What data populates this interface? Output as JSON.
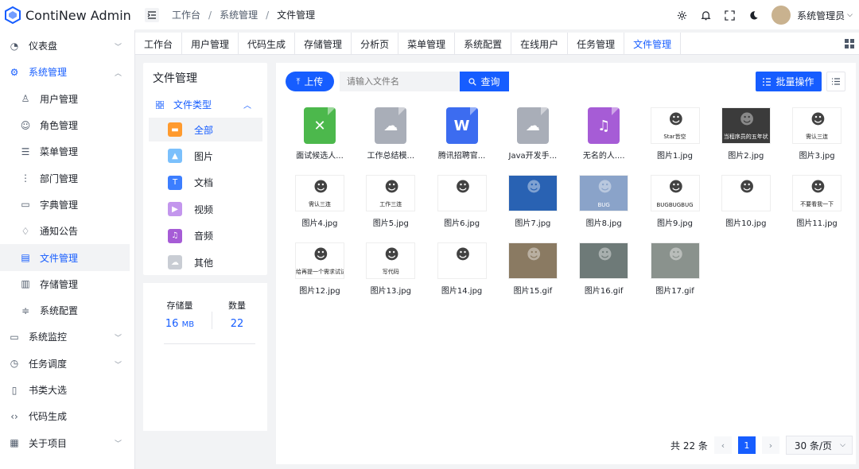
{
  "app": {
    "title": "ContiNew Admin"
  },
  "header": {
    "breadcrumb": [
      "工作台",
      "系统管理",
      "文件管理"
    ],
    "user_name": "系统管理员"
  },
  "sidebar": {
    "items": [
      {
        "label": "仪表盘",
        "icon": "dashboard-icon",
        "arrow": "down"
      },
      {
        "label": "系统管理",
        "icon": "gear-icon",
        "arrow": "up"
      },
      {
        "label": "用户管理",
        "icon": "user-icon"
      },
      {
        "label": "角色管理",
        "icon": "role-icon"
      },
      {
        "label": "菜单管理",
        "icon": "menu-icon"
      },
      {
        "label": "部门管理",
        "icon": "department-icon"
      },
      {
        "label": "字典管理",
        "icon": "dictionary-icon"
      },
      {
        "label": "通知公告",
        "icon": "bell-icon"
      },
      {
        "label": "文件管理",
        "icon": "file-icon"
      },
      {
        "label": "存储管理",
        "icon": "storage-icon"
      },
      {
        "label": "系统配置",
        "icon": "config-icon"
      },
      {
        "label": "系统监控",
        "icon": "monitor-icon",
        "arrow": "down"
      },
      {
        "label": "任务调度",
        "icon": "clock-icon",
        "arrow": "down"
      },
      {
        "label": "书类大选",
        "icon": "book-icon"
      },
      {
        "label": "代码生成",
        "icon": "code-icon"
      },
      {
        "label": "关于项目",
        "icon": "apps-icon",
        "arrow": "down"
      }
    ]
  },
  "tabs": [
    "工作台",
    "用户管理",
    "代码生成",
    "存储管理",
    "分析页",
    "菜单管理",
    "系统配置",
    "在线用户",
    "任务管理",
    "文件管理"
  ],
  "left_panel": {
    "title": "文件管理",
    "type_header": "文件类型",
    "types": [
      {
        "label": "全部",
        "color": "#ff9a2e"
      },
      {
        "label": "图片",
        "color": "#7bc0fc"
      },
      {
        "label": "文档",
        "color": "#3c7eff"
      },
      {
        "label": "视频",
        "color": "#c396ed"
      },
      {
        "label": "音频",
        "color": "#a65cd6"
      },
      {
        "label": "其他",
        "color": "#c9cdd4"
      }
    ]
  },
  "stats": {
    "storage_label": "存储量",
    "storage_value": "16",
    "storage_unit": "MB",
    "count_label": "数量",
    "count_value": "22"
  },
  "toolbar": {
    "upload_label": "上传",
    "search_placeholder": "请输入文件名",
    "search_label": "查询",
    "batch_label": "批量操作"
  },
  "files": [
    {
      "name": "面试候选人...",
      "kind": "excel",
      "color": "#4cb84c",
      "glyph": "✕"
    },
    {
      "name": "工作总结模...",
      "kind": "other",
      "color": "#a9aeb8",
      "glyph": "☁"
    },
    {
      "name": "腾讯招聘官...",
      "kind": "word",
      "color": "#3c6cf0",
      "glyph": "W"
    },
    {
      "name": "Java开发手...",
      "kind": "other",
      "color": "#a9aeb8",
      "glyph": "☁"
    },
    {
      "name": "无名的人....",
      "kind": "audio",
      "color": "#a65cd6",
      "glyph": "♫"
    },
    {
      "name": "图片1.jpg",
      "kind": "image",
      "caption": "Star皆空"
    },
    {
      "name": "图片2.jpg",
      "kind": "image",
      "caption": "当程序员的五年状"
    },
    {
      "name": "图片3.jpg",
      "kind": "image",
      "caption": "需认三连"
    },
    {
      "name": "图片4.jpg",
      "kind": "image",
      "caption": "需认三连"
    },
    {
      "name": "图片5.jpg",
      "kind": "image",
      "caption": "工作三连"
    },
    {
      "name": "图片6.jpg",
      "kind": "image",
      "caption": ""
    },
    {
      "name": "图片7.jpg",
      "kind": "image",
      "caption": ""
    },
    {
      "name": "图片8.jpg",
      "kind": "image",
      "caption": "BUG"
    },
    {
      "name": "图片9.jpg",
      "kind": "image",
      "caption": "BUGBUGBUG"
    },
    {
      "name": "图片10.jpg",
      "kind": "image",
      "caption": ""
    },
    {
      "name": "图片11.jpg",
      "kind": "image",
      "caption": "不要看我一下"
    },
    {
      "name": "图片12.jpg",
      "kind": "image",
      "caption": "给再提一个需求试试"
    },
    {
      "name": "图片13.jpg",
      "kind": "image",
      "caption": "写代码"
    },
    {
      "name": "图片14.jpg",
      "kind": "image",
      "caption": ""
    },
    {
      "name": "图片15.gif",
      "kind": "image",
      "caption": ""
    },
    {
      "name": "图片16.gif",
      "kind": "image",
      "caption": ""
    },
    {
      "name": "图片17.gif",
      "kind": "image",
      "caption": ""
    }
  ],
  "pagination": {
    "total": "共 22 条",
    "current": "1",
    "page_size": "30 条/页",
    "prev": "‹",
    "next": "›"
  },
  "colors": {
    "primary": "#165dff"
  }
}
